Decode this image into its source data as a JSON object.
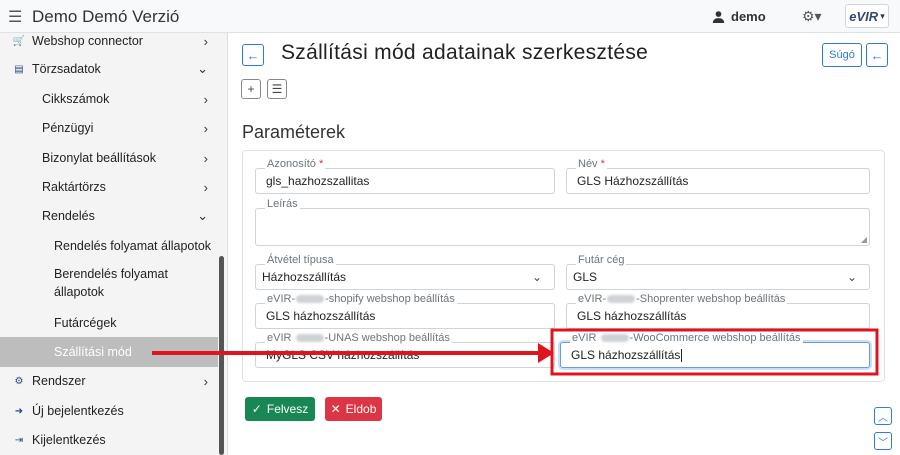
{
  "header": {
    "menu_icon": "hamburger-icon",
    "title": "Demo Demó Verzió",
    "user_icon": "user-icon",
    "username": "demo",
    "settings_icon": "gear-icon",
    "logo_text": "eVIR",
    "logo_chevron": "▾"
  },
  "sidebar": {
    "items": [
      {
        "label": "Webshop connector",
        "icon": "cart-icon"
      },
      {
        "label": "Törzsadatok",
        "icon": "database-icon"
      },
      {
        "label": "Cikkszámok"
      },
      {
        "label": "Pénzügyi"
      },
      {
        "label": "Bizonylat beállítások"
      },
      {
        "label": "Raktártörzs"
      },
      {
        "label": "Rendelés"
      },
      {
        "label": "Rendelés folyamat állapotok"
      },
      {
        "label": "Berendelés folyamat állapotok"
      },
      {
        "label": "Futárcégek"
      },
      {
        "label": "Szállítási mód"
      },
      {
        "label": "Rendszer",
        "icon": "gears-icon"
      },
      {
        "label": "Új bejelentkezés",
        "icon": "sign-in-icon"
      },
      {
        "label": "Kijelentkezés",
        "icon": "sign-out-icon"
      }
    ]
  },
  "page": {
    "title": "Szállítási mód adatainak szerkesztése",
    "help_label": "Súgó",
    "section_title": "Paraméterek"
  },
  "form": {
    "azonosito": {
      "label": "Azonosító",
      "value": "gls_hazhozszallitas"
    },
    "nev": {
      "label": "Név",
      "value": "GLS Házhozszállítás"
    },
    "leiras": {
      "label": "Leírás",
      "value": ""
    },
    "atvetel": {
      "label": "Átvétel típusa",
      "value": "Házhozszállítás"
    },
    "futar": {
      "label": "Futár cég",
      "value": "GLS"
    },
    "shopify": {
      "label_pre": "eVIR-",
      "label_post": "-shopify webshop beállítás",
      "value": "GLS házhozszállítás"
    },
    "shoprenter": {
      "label_pre": "eVIR-",
      "label_post": "-Shoprenter webshop beállítás",
      "value": "GLS házhozszállítás"
    },
    "unas": {
      "label_pre": "eVIR",
      "label_post": "-UNAS webshop beállítás",
      "value": "MyGLS CSV házhozszállítás"
    },
    "woocommerce": {
      "label_pre": "eVIR",
      "label_post": "-WooCommerce webshop beállítás",
      "value": "GLS házhozszállítás"
    }
  },
  "actions": {
    "save_label": "Felvesz",
    "delete_label": "Eldob"
  },
  "colors": {
    "primary": "#2c7be5",
    "success": "#198754",
    "danger": "#dc3545",
    "annotation": "#e0141e"
  }
}
